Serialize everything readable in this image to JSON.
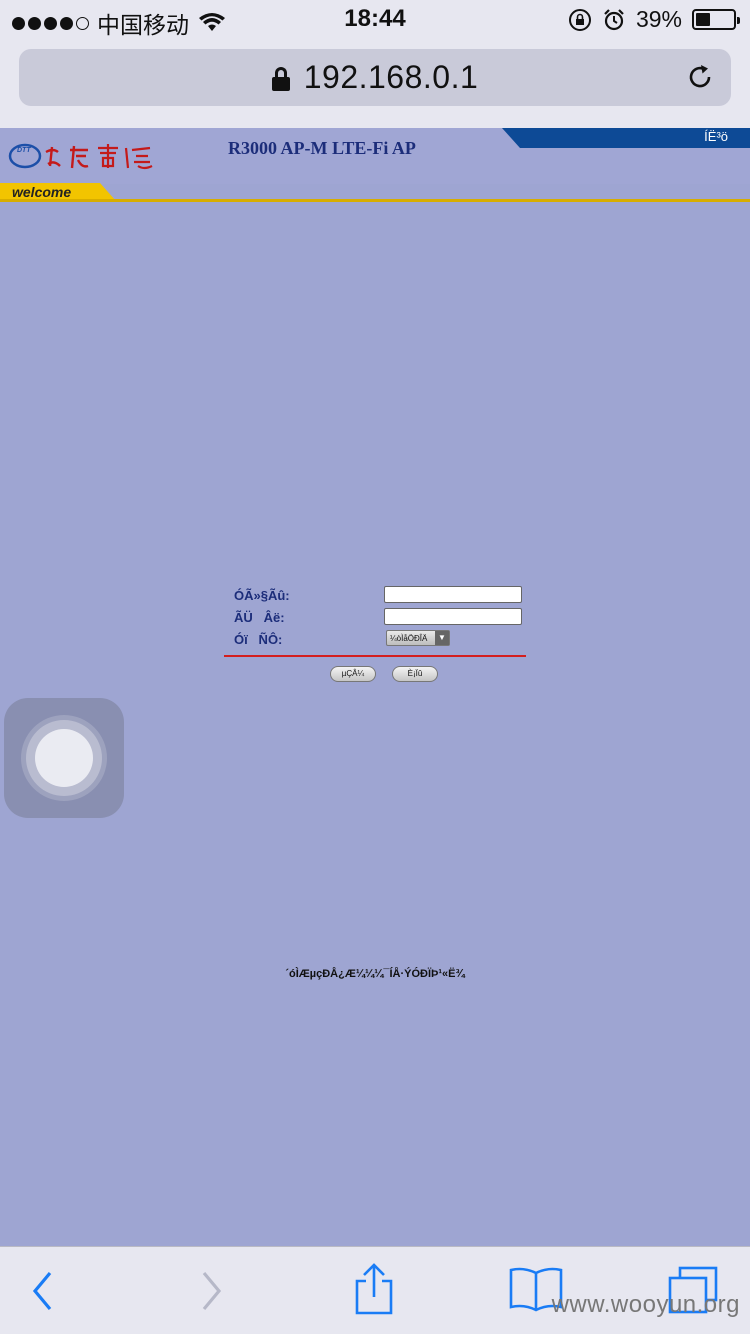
{
  "status_bar": {
    "carrier": "中国移动",
    "time": "18:44",
    "battery_percent": "39%",
    "battery_level": 0.39,
    "icons": [
      "signal-dots",
      "wifi-icon",
      "orientation-lock-icon",
      "alarm-icon",
      "battery-icon"
    ]
  },
  "address_bar": {
    "url": "192.168.0.1",
    "icons": [
      "lock-icon",
      "reload-icon"
    ]
  },
  "router_page": {
    "top_right_link": "ÍË³ö",
    "product_title": "R3000 AP-M LTE-Fi AP",
    "welcome_label": "welcome",
    "logo_text": "大唐电信",
    "form": {
      "username_label": "ÓÃ»§Ãû:",
      "password_label": "ÃÜ   Âë:",
      "language_label": "Óï   ÑÔ:",
      "username_value": "",
      "password_value": "",
      "language_selected": "¼òÌåÖÐÎÄ",
      "login_button": "µÇÂ¼",
      "cancel_button": "È¡Ïû"
    },
    "footer_note": "´óÌÆµçÐÅ¿Æ¼¼¼¯ÍÅ·ÝÓÐÏÞ¹«Ë¾"
  },
  "toolbar": {
    "icons": [
      "back-icon",
      "forward-icon",
      "share-icon",
      "bookmarks-icon",
      "tabs-icon"
    ],
    "watermark": "www.wooyun.org"
  },
  "colors": {
    "page_background": "#9ea5d2",
    "title_blue": "#1c2d7a",
    "welcome_yellow": "#f2c400",
    "divider_red": "#d41e1e",
    "ios_blue": "#1a7cf5"
  }
}
